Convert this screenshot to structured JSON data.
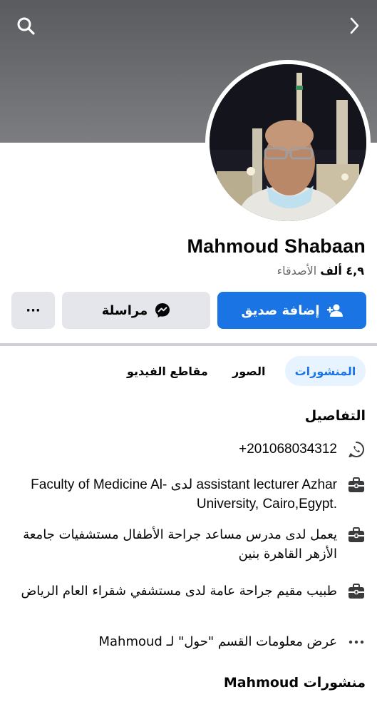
{
  "profile": {
    "name": "Mahmoud Shabaan",
    "friends_count": "٤,٩ ألف",
    "friends_label": "الأصدقاء"
  },
  "actions": {
    "add_friend": "إضافة صديق",
    "message": "مراسلة",
    "more": "···"
  },
  "tabs": [
    {
      "label": "المنشورات",
      "active": true
    },
    {
      "label": "الصور",
      "active": false
    },
    {
      "label": "مقاطع الفيديو",
      "active": false
    }
  ],
  "details": {
    "title": "التفاصيل",
    "phone": "+201068034312",
    "job1": "Faculty of Medicine Al- لدى assistant lecturer Azhar University, Cairo,Egypt.",
    "job2": "يعمل لدى مدرس مساعد جراحة الأطفال مستشفيات جامعة الأزهر القاهرة بنين",
    "job3": "طبيب مقيم جراحة عامة لدى مستشفي شقراء العام الرياض",
    "about_link": "عرض معلومات القسم \"حول\" لـ Mahmoud"
  },
  "posts_title": "منشورات Mahmoud",
  "icons": {
    "search": "search-icon",
    "next": "chevron-right-icon",
    "phone": "whatsapp-icon",
    "work": "briefcase-icon",
    "about": "ellipsis-icon"
  },
  "colors": {
    "accent": "#1b74e4",
    "tab_active_bg": "#e7f3ff",
    "secondary_btn": "#e4e6eb",
    "muted_text": "#65676b"
  }
}
